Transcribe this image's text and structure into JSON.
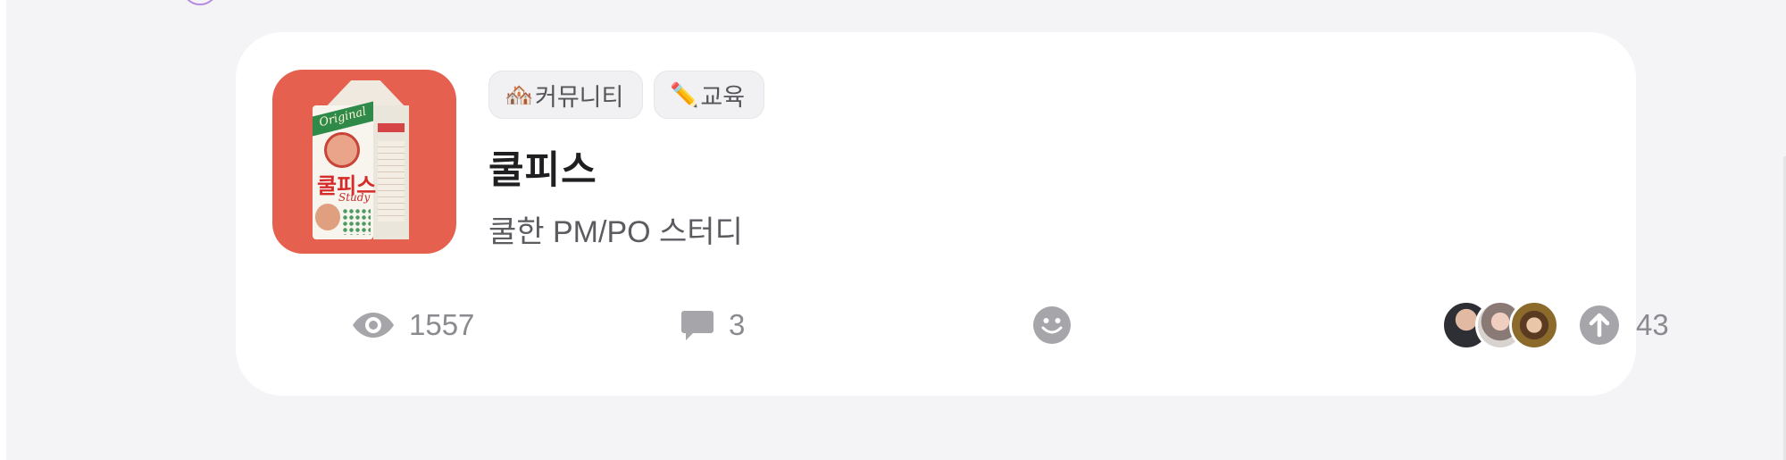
{
  "card": {
    "thumbnail": {
      "alt": "쿨피스 Study carton",
      "logo_text": "Original",
      "name_text": "쿨피스",
      "study_text": "Study"
    },
    "tags": [
      {
        "emoji": "🏘️",
        "label": "커뮤니티"
      },
      {
        "emoji": "✏️",
        "label": "교육"
      }
    ],
    "title": "쿨피스",
    "subtitle": "쿨한 PM/PO 스터디",
    "stats": {
      "views": "1557",
      "comments": "3",
      "upvotes": "43"
    },
    "icons": {
      "views": "eye-icon",
      "comments": "speech-bubble-icon",
      "reaction": "smiley-icon",
      "upvote": "arrow-up-circle-icon"
    },
    "colors": {
      "thumbnail_bg": "#e5604e",
      "icon_gray": "#a6a6aa"
    }
  }
}
